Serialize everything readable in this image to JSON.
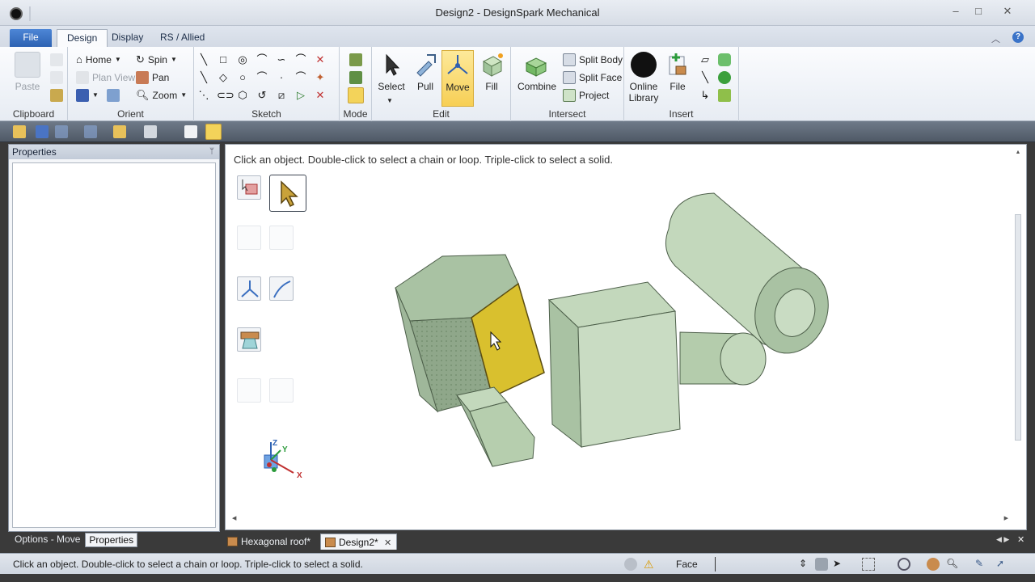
{
  "window": {
    "title": "Design2 - DesignSpark Mechanical",
    "minimize": "–",
    "maximize": "□",
    "close": "✕"
  },
  "tabs": {
    "file": "File",
    "design": "Design",
    "display": "Display",
    "rs_allied": "RS / Allied",
    "help": "?"
  },
  "ribbon": {
    "clipboard": {
      "label": "Clipboard",
      "paste": "Paste"
    },
    "orient": {
      "label": "Orient",
      "home": "Home",
      "plan_view": "Plan View",
      "spin": "Spin",
      "pan": "Pan",
      "zoom": "Zoom"
    },
    "sketch": {
      "label": "Sketch"
    },
    "mode": {
      "label": "Mode"
    },
    "edit": {
      "label": "Edit",
      "select": "Select",
      "pull": "Pull",
      "move": "Move",
      "fill": "Fill"
    },
    "intersect": {
      "label": "Intersect",
      "combine": "Combine",
      "split_body": "Split Body",
      "split_face": "Split Face",
      "project": "Project"
    },
    "insert": {
      "label": "Insert",
      "online_library_1": "Online",
      "online_library_2": "Library",
      "file": "File"
    }
  },
  "panel": {
    "title": "Properties",
    "pin": "ᛘ",
    "bottom_tabs": [
      "Options - Move",
      "Properties"
    ]
  },
  "viewport": {
    "hint": "Click an object.  Double-click to select a chain or loop.  Triple-click to select a solid.",
    "axis_x": "X",
    "axis_y": "Y",
    "axis_z": "Z"
  },
  "doc_tabs": [
    {
      "label": "Hexagonal roof*"
    },
    {
      "label": "Design2*"
    }
  ],
  "status": {
    "text": "Click an object.  Double-click to select a chain or loop.  Triple-click to select a solid.",
    "selection_filter": "Face"
  },
  "colors": {
    "model_fill": "#c9dcc3",
    "model_dark": "#9fb79a",
    "selected_face": "#d9c02e",
    "accent": "#2d62b3"
  }
}
